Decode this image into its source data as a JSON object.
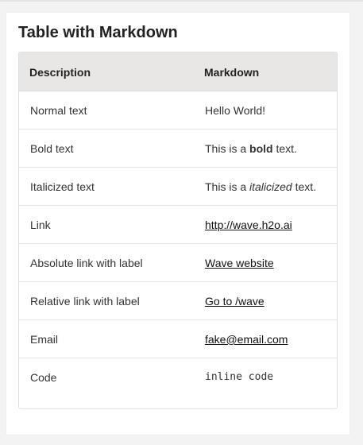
{
  "card": {
    "title": "Table with Markdown"
  },
  "table": {
    "columns": [
      "Description",
      "Markdown"
    ],
    "rows": [
      {
        "description": "Normal text",
        "markdown": "Hello World!"
      },
      {
        "description": "Bold text",
        "md_pre": "This is a ",
        "md_bold": "bold",
        "md_post": " text."
      },
      {
        "description": "Italicized text",
        "md_pre": "This is a ",
        "md_italic": "italicized",
        "md_post": " text."
      },
      {
        "description": "Link",
        "link": "http://wave.h2o.ai"
      },
      {
        "description": "Absolute link with label",
        "link": "Wave website"
      },
      {
        "description": "Relative link with label",
        "link": "Go to /wave"
      },
      {
        "description": "Email",
        "link": "fake@email.com"
      },
      {
        "description": "Code",
        "code": "inline code"
      }
    ]
  }
}
